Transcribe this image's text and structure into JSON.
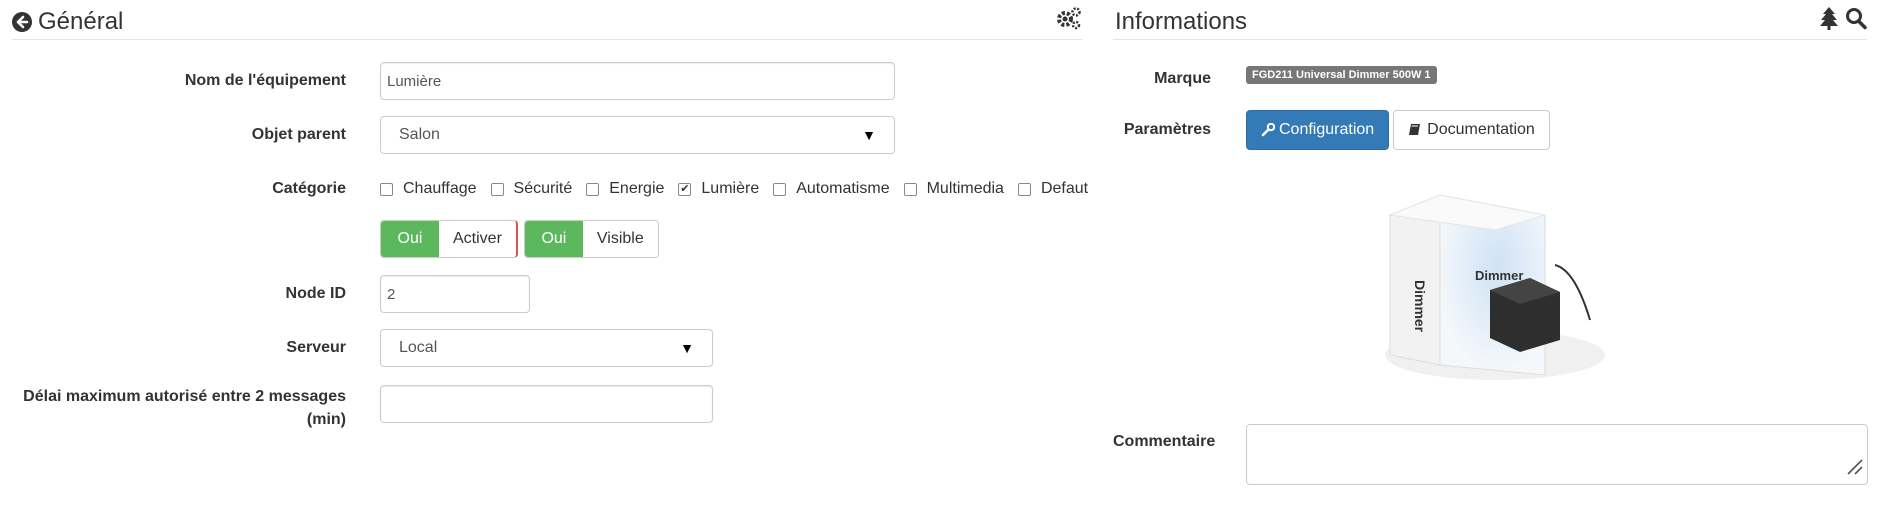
{
  "general": {
    "title": "Général",
    "back_icon": "arrow-circle-left-icon",
    "tools_icon": "cogs-icon",
    "fields": {
      "name_label": "Nom de l'équipement",
      "name_value": "Lumière",
      "parent_label": "Objet parent",
      "parent_value": "Salon",
      "category_label": "Catégorie",
      "categories": [
        {
          "label": "Chauffage",
          "checked": false
        },
        {
          "label": "Sécurité",
          "checked": false
        },
        {
          "label": "Energie",
          "checked": false
        },
        {
          "label": "Lumière",
          "checked": true
        },
        {
          "label": "Automatisme",
          "checked": false
        },
        {
          "label": "Multimedia",
          "checked": false
        },
        {
          "label": "Defaut",
          "checked": false
        }
      ],
      "toggle_on": "Oui",
      "activate_label": "Activer",
      "visible_label": "Visible",
      "node_label": "Node ID",
      "node_value": "2",
      "server_label": "Serveur",
      "server_value": "Local",
      "delay_label_line1": "Délai maximum autorisé entre 2 messages",
      "delay_label_line2": "(min)",
      "delay_value": ""
    }
  },
  "informations": {
    "title": "Informations",
    "tree_icon": "tree-icon",
    "search_icon": "search-icon",
    "brand_label": "Marque",
    "brand_value": "FGD211 Universal Dimmer 500W 1",
    "params_label": "Paramètres",
    "config_button": "Configuration",
    "doc_button": "Documentation",
    "product_text": "Dimmer",
    "product_box_text": "Dimmer",
    "comment_label": "Commentaire",
    "comment_value": ""
  },
  "colors": {
    "primary": "#337ab7",
    "success": "#5cb85c",
    "badge": "#777777",
    "divider_red": "#d9534f"
  }
}
